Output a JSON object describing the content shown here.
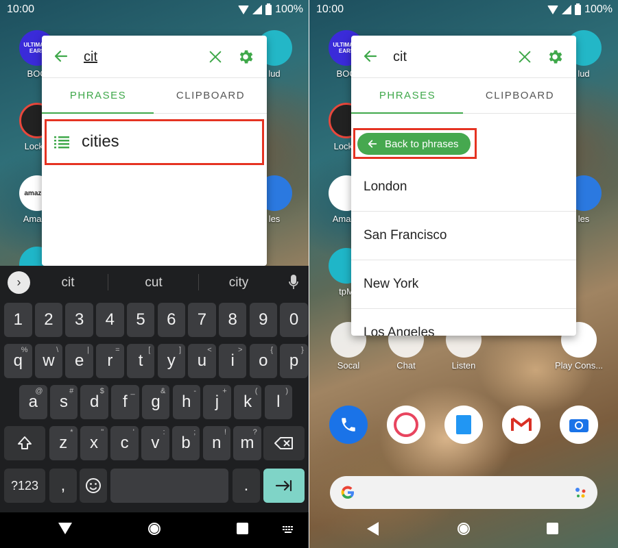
{
  "status": {
    "time": "10:00",
    "battery": "100%"
  },
  "left": {
    "apps": [
      {
        "label": "BOO",
        "icon_text": "ULTIMATE EARS",
        "color": "#3a2bd9"
      },
      {
        "label": "Lockw",
        "icon_text": "",
        "color": "#1c1c1c"
      },
      {
        "label": "Amazo",
        "icon_text": "amazon",
        "color": "#ffffff"
      },
      {
        "label": "",
        "icon_text": "",
        "color": "#1fb6c8"
      }
    ],
    "right_apps": [
      {
        "label": "lud"
      },
      {
        "label": "les"
      }
    ],
    "search_query": "cit",
    "tabs": {
      "phrases": "PHRASES",
      "clipboard": "CLIPBOARD"
    },
    "phrase": {
      "label": "cities"
    }
  },
  "keyboard": {
    "suggestions": [
      "cit",
      "cut",
      "city"
    ],
    "row_numbers": [
      "1",
      "2",
      "3",
      "4",
      "5",
      "6",
      "7",
      "8",
      "9",
      "0"
    ],
    "row_q": [
      {
        "k": "q",
        "s": "%"
      },
      {
        "k": "w",
        "s": "\\"
      },
      {
        "k": "e",
        "s": "|"
      },
      {
        "k": "r",
        "s": "="
      },
      {
        "k": "t",
        "s": "["
      },
      {
        "k": "y",
        "s": "]"
      },
      {
        "k": "u",
        "s": "<"
      },
      {
        "k": "i",
        "s": ">"
      },
      {
        "k": "o",
        "s": "{"
      },
      {
        "k": "p",
        "s": "}"
      }
    ],
    "row_a": [
      {
        "k": "a",
        "s": "@"
      },
      {
        "k": "s",
        "s": "#"
      },
      {
        "k": "d",
        "s": "$"
      },
      {
        "k": "f",
        "s": "_"
      },
      {
        "k": "g",
        "s": "&"
      },
      {
        "k": "h",
        "s": "-"
      },
      {
        "k": "j",
        "s": "+"
      },
      {
        "k": "k",
        "s": "("
      },
      {
        "k": "l",
        "s": ")"
      }
    ],
    "row_z": [
      {
        "k": "z",
        "s": "*"
      },
      {
        "k": "x",
        "s": "\""
      },
      {
        "k": "c",
        "s": "'"
      },
      {
        "k": "v",
        "s": ":"
      },
      {
        "k": "b",
        "s": ";"
      },
      {
        "k": "n",
        "s": "!"
      },
      {
        "k": "m",
        "s": "?"
      }
    ],
    "sym_label": "?123",
    "comma": ",",
    "period": "."
  },
  "right": {
    "search_query": "cit",
    "tabs": {
      "phrases": "PHRASES",
      "clipboard": "CLIPBOARD"
    },
    "back_label": "Back to phrases",
    "cities": [
      "London",
      "San Francisco",
      "New York",
      "Los Angeles"
    ],
    "folders": [
      {
        "label": "Socal"
      },
      {
        "label": "Chat"
      },
      {
        "label": "Listen"
      },
      {
        "label": "Play Cons..."
      }
    ],
    "left_apps": [
      {
        "label": "BOO",
        "icon_text": "ULTIMATE EARS"
      },
      {
        "label": "Lockw"
      },
      {
        "label": "Amazo"
      },
      {
        "label": "tpM"
      }
    ],
    "right_apps": [
      {
        "label": "lud"
      },
      {
        "label": "les"
      }
    ]
  },
  "colors": {
    "accent": "#3fa84a",
    "highlight": "#e53322",
    "enter_key": "#7fd4c7"
  }
}
